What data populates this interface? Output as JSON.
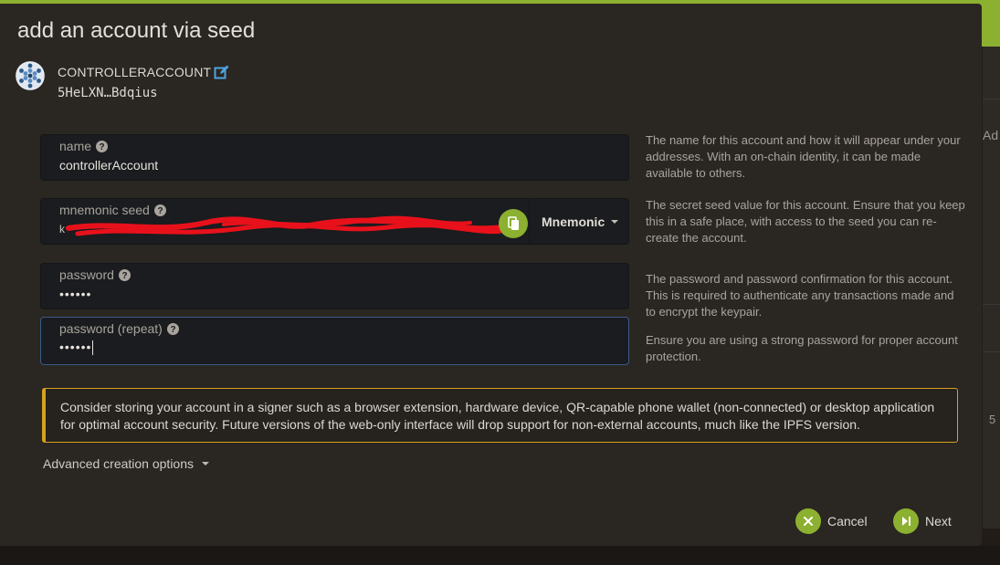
{
  "modal": {
    "title": "add an account via seed"
  },
  "account": {
    "name": "CONTROLLERACCOUNT",
    "address": "5HeLXN…Bdqius"
  },
  "fields": {
    "name": {
      "label": "name",
      "value": "controllerAccount"
    },
    "seed": {
      "label": "mnemonic seed",
      "value": "k",
      "type_label": "Mnemonic"
    },
    "password": {
      "label": "password",
      "value": "••••••"
    },
    "password_repeat": {
      "label": "password (repeat)",
      "value": "••••••"
    }
  },
  "help": {
    "name": "The name for this account and how it will appear under your addresses. With an on-chain identity, it can be made available to others.",
    "seed": "The secret seed value for this account. Ensure that you keep this in a safe place, with access to the seed you can re-create the account.",
    "password": "The password and password confirmation for this account. This is required to authenticate any transactions made and to encrypt the keypair.",
    "password_repeat": "Ensure you are using a strong password for proper account protection."
  },
  "warning": "Consider storing your account in a signer such as a browser extension, hardware device, QR-capable phone wallet (non-connected) or desktop application for optimal account security. Future versions of the web-only interface will drop support for non-external accounts, much like the IPFS version.",
  "advanced_label": "Advanced creation options",
  "buttons": {
    "cancel": "Cancel",
    "next": "Next"
  },
  "background": {
    "right_text_1": "Ad",
    "right_text_2": "5"
  },
  "colors": {
    "accent": "#8cb030",
    "warning": "#d4a21d",
    "modal_bg": "#2a2622",
    "input_bg": "#1a1c1f"
  }
}
